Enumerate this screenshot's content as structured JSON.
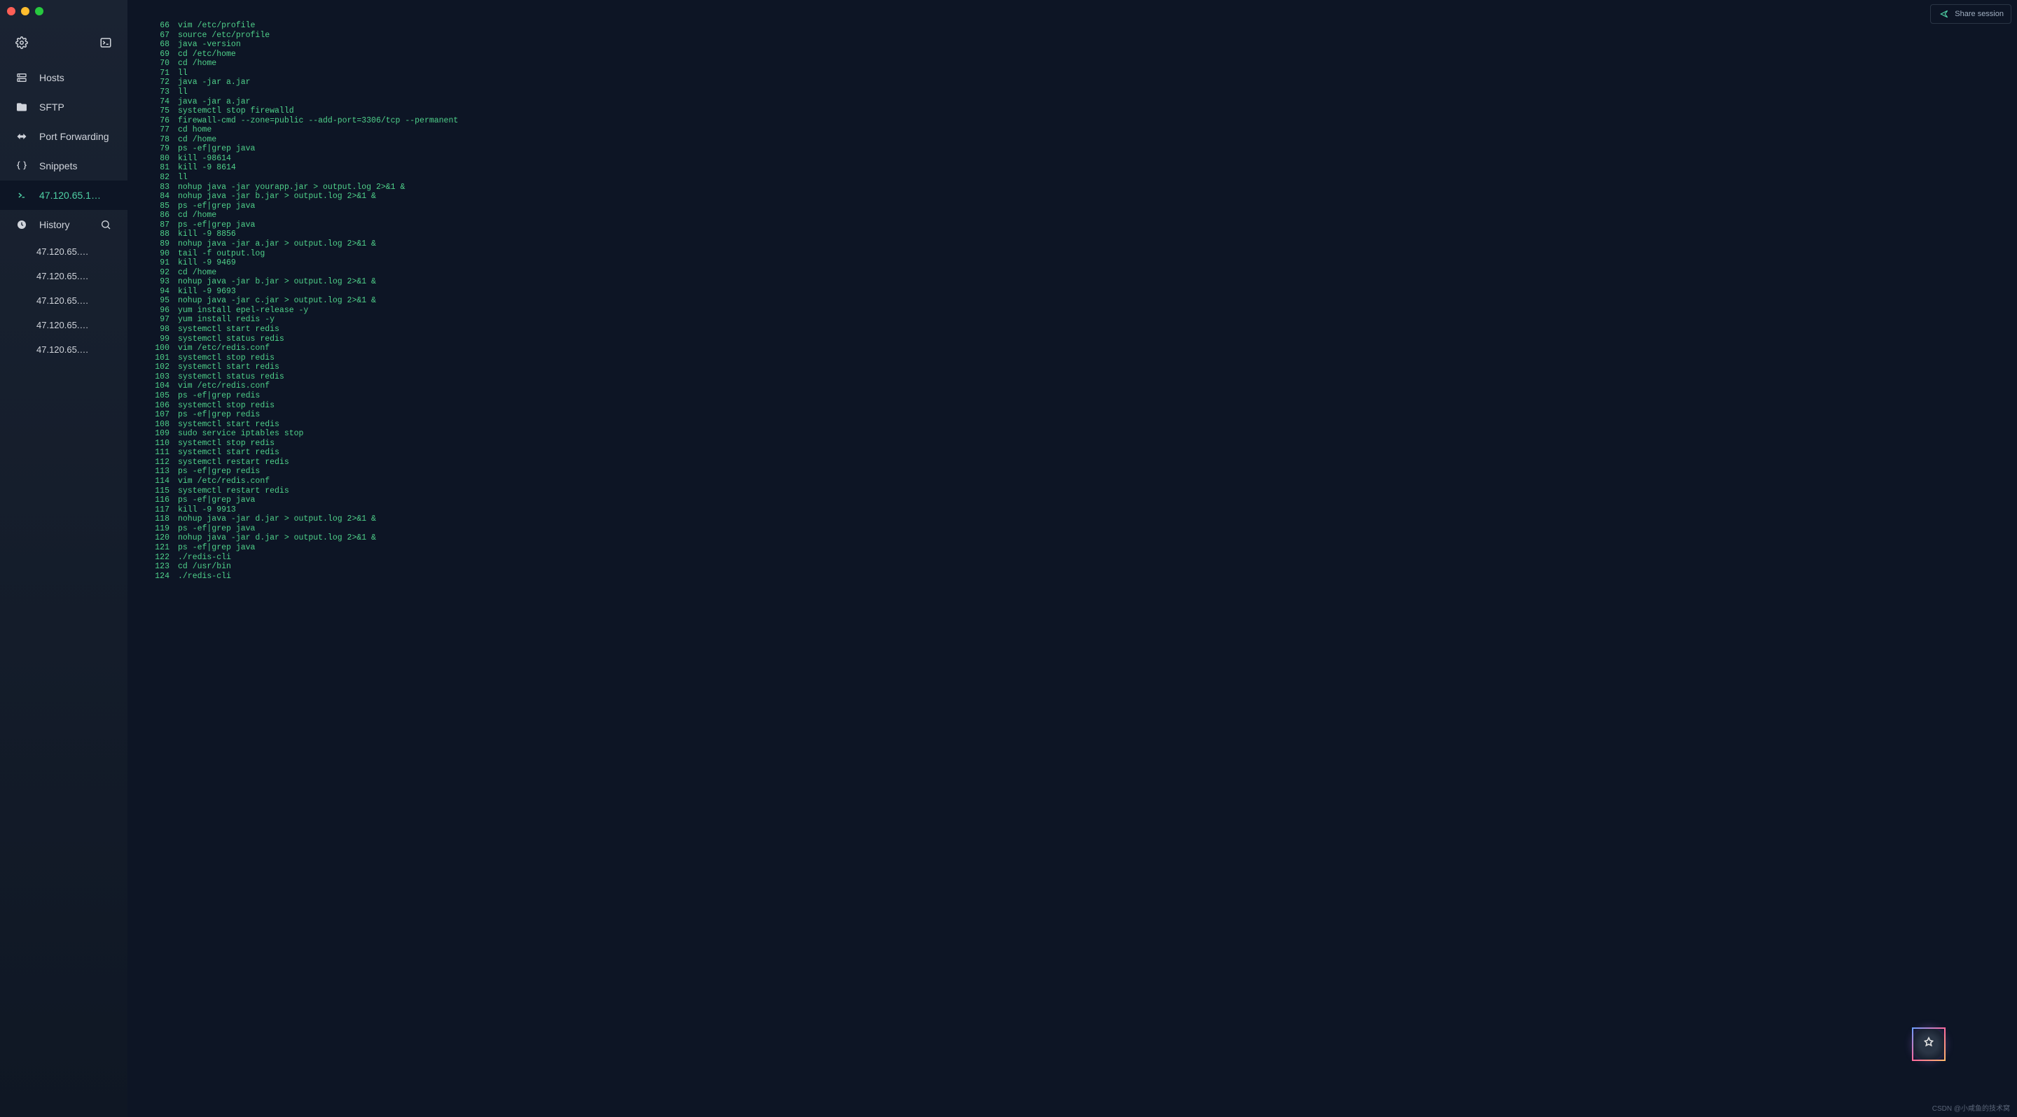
{
  "share_label": "Share session",
  "nav": {
    "hosts": "Hosts",
    "sftp": "SFTP",
    "port_forwarding": "Port Forwarding",
    "snippets": "Snippets",
    "active_session": "47.120.65.1…"
  },
  "history": {
    "label": "History",
    "items": [
      "47.120.65.…",
      "47.120.65.…",
      "47.120.65.…",
      "47.120.65.…",
      "47.120.65.…"
    ]
  },
  "terminal_lines": [
    {
      "n": 66,
      "c": "vim /etc/profile"
    },
    {
      "n": 67,
      "c": "source /etc/profile"
    },
    {
      "n": 68,
      "c": "java -version"
    },
    {
      "n": 69,
      "c": "cd /etc/home"
    },
    {
      "n": 70,
      "c": "cd /home"
    },
    {
      "n": 71,
      "c": "ll"
    },
    {
      "n": 72,
      "c": "java -jar a.jar"
    },
    {
      "n": 73,
      "c": "ll"
    },
    {
      "n": 74,
      "c": "java -jar a.jar"
    },
    {
      "n": 75,
      "c": "systemctl stop firewalld"
    },
    {
      "n": 76,
      "c": "firewall-cmd --zone=public --add-port=3306/tcp --permanent"
    },
    {
      "n": 77,
      "c": "cd home"
    },
    {
      "n": 78,
      "c": "cd /home"
    },
    {
      "n": 79,
      "c": "ps -ef|grep java"
    },
    {
      "n": 80,
      "c": "kill -98614"
    },
    {
      "n": 81,
      "c": "kill -9 8614"
    },
    {
      "n": 82,
      "c": "ll"
    },
    {
      "n": 83,
      "c": "nohup java -jar yourapp.jar > output.log 2>&1 &"
    },
    {
      "n": 84,
      "c": "nohup java -jar b.jar > output.log 2>&1 &"
    },
    {
      "n": 85,
      "c": "ps -ef|grep java"
    },
    {
      "n": 86,
      "c": "cd /home"
    },
    {
      "n": 87,
      "c": "ps -ef|grep java"
    },
    {
      "n": 88,
      "c": "kill -9 8856"
    },
    {
      "n": 89,
      "c": "nohup java -jar a.jar > output.log 2>&1 &"
    },
    {
      "n": 90,
      "c": "tail -f output.log"
    },
    {
      "n": 91,
      "c": "kill -9 9469"
    },
    {
      "n": 92,
      "c": "cd /home"
    },
    {
      "n": 93,
      "c": "nohup java -jar b.jar > output.log 2>&1 &"
    },
    {
      "n": 94,
      "c": "kill -9 9693"
    },
    {
      "n": 95,
      "c": "nohup java -jar c.jar > output.log 2>&1 &"
    },
    {
      "n": 96,
      "c": "yum install epel-release -y"
    },
    {
      "n": 97,
      "c": "yum install redis -y"
    },
    {
      "n": 98,
      "c": "systemctl start redis"
    },
    {
      "n": 99,
      "c": "systemctl status redis"
    },
    {
      "n": 100,
      "c": "vim /etc/redis.conf"
    },
    {
      "n": 101,
      "c": "systemctl stop redis"
    },
    {
      "n": 102,
      "c": "systemctl start redis"
    },
    {
      "n": 103,
      "c": "systemctl status redis"
    },
    {
      "n": 104,
      "c": "vim /etc/redis.conf"
    },
    {
      "n": 105,
      "c": "ps -ef|grep redis"
    },
    {
      "n": 106,
      "c": "systemctl stop redis"
    },
    {
      "n": 107,
      "c": "ps -ef|grep redis"
    },
    {
      "n": 108,
      "c": "systemctl start redis"
    },
    {
      "n": 109,
      "c": "sudo service iptables stop"
    },
    {
      "n": 110,
      "c": "systemctl stop redis"
    },
    {
      "n": 111,
      "c": "systemctl start redis"
    },
    {
      "n": 112,
      "c": "systemctl restart redis"
    },
    {
      "n": 113,
      "c": "ps -ef|grep redis"
    },
    {
      "n": 114,
      "c": "vim /etc/redis.conf"
    },
    {
      "n": 115,
      "c": "systemctl restart redis"
    },
    {
      "n": 116,
      "c": "ps -ef|grep java"
    },
    {
      "n": 117,
      "c": "kill -9 9913"
    },
    {
      "n": 118,
      "c": "nohup java -jar d.jar > output.log 2>&1 &"
    },
    {
      "n": 119,
      "c": "ps -ef|grep java"
    },
    {
      "n": 120,
      "c": "nohup java -jar d.jar > output.log 2>&1 &"
    },
    {
      "n": 121,
      "c": "ps -ef|grep java"
    },
    {
      "n": 122,
      "c": "./redis-cli"
    },
    {
      "n": 123,
      "c": "cd /usr/bin"
    },
    {
      "n": 124,
      "c": "./redis-cli"
    }
  ],
  "watermark": "CSDN @小咸鱼的技术窝"
}
